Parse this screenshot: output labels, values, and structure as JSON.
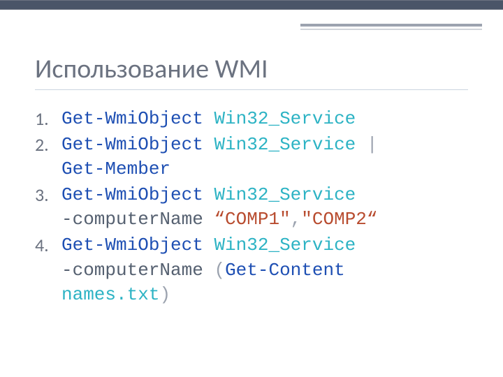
{
  "title": "Использование WMI",
  "items": [
    {
      "num": "1."
    },
    {
      "num": "2."
    },
    {
      "num": "3."
    },
    {
      "num": "4."
    }
  ],
  "t": {
    "gwo": "Get-WmiObject",
    "w32": "Win32_Service",
    "gm": "Get-Member",
    "pipe": "|",
    "cn": "-computerName",
    "q1": "“COMP1\"",
    "comma": ",",
    "q2": "\"COMP2“",
    "po": "(",
    "gc": "Get-Content",
    "file": "names.txt",
    "pc": ")"
  }
}
